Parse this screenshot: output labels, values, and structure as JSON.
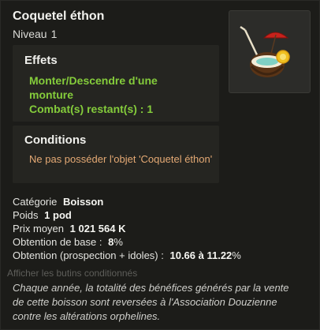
{
  "item": {
    "name": "Coquetel éthon",
    "level_label": "Niveau",
    "level_value": "1"
  },
  "effects": {
    "title": "Effets",
    "lines": [
      "Monter/Descendre d'une monture",
      "Combat(s) restant(s) : 1"
    ]
  },
  "conditions": {
    "title": "Conditions",
    "text": "Ne pas posséder l'objet 'Coquetel éthon'"
  },
  "stats": {
    "category_label": "Catégorie",
    "category_value": "Boisson",
    "weight_label": "Poids",
    "weight_value": "1 pod",
    "price_label": "Prix moyen",
    "price_value": "1 021 564 K",
    "base_drop_label": "Obtention de base :",
    "base_drop_value": "8",
    "base_drop_unit": "%",
    "prospect_label": "Obtention (prospection + idoles) :",
    "prospect_value": "10.66 à 11.22",
    "prospect_unit": "%"
  },
  "show_drops_label": "Afficher les butins conditionnés",
  "description": "Chaque année, la totalité des bénéfices générés par la vente de cette boisson sont reversées à l'Association Douzienne contre les altérations orphelines.",
  "colors": {
    "effect_green": "#84cc3b",
    "condition_orange": "#e4a974",
    "background": "#1c1c19"
  },
  "icons": {
    "item": "coconut-cocktail-icon"
  }
}
